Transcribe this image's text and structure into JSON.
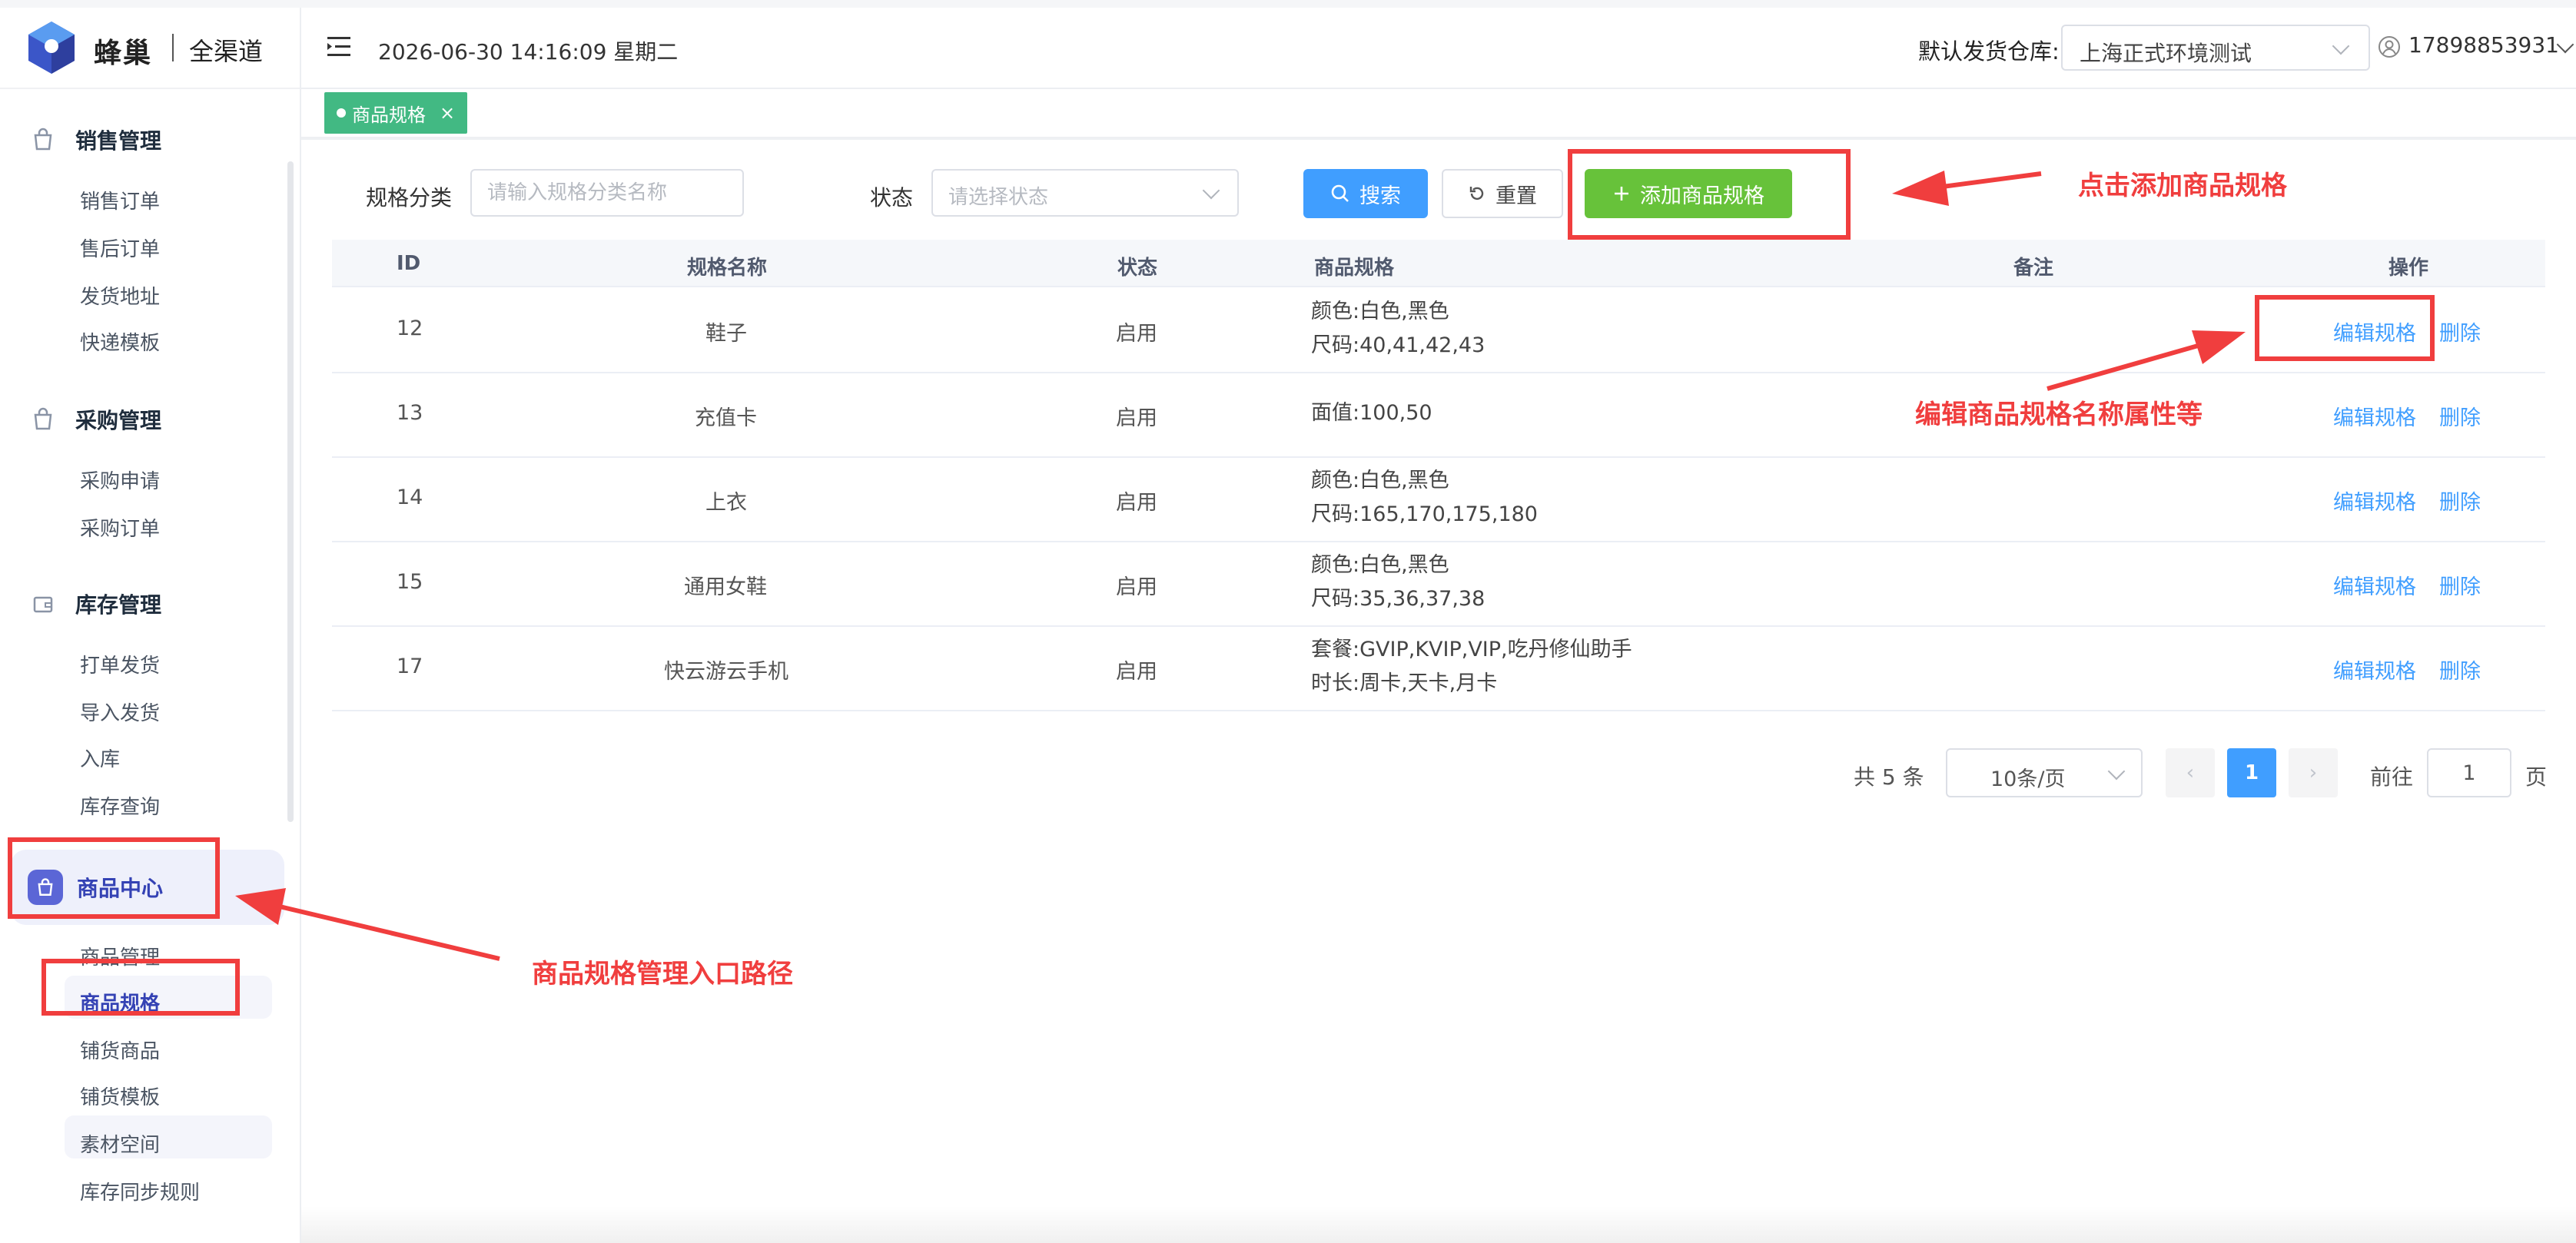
{
  "app": {
    "brand": "蜂巢",
    "sub": "全渠道",
    "datetime": "2026-06-30 14:16:09 星期二",
    "warehouse_label": "默认发货仓库:",
    "warehouse_value": "上海正式环境测试",
    "user": "17898853931"
  },
  "sidebar": {
    "groups": [
      {
        "label": "销售管理",
        "items": [
          "销售订单",
          "售后订单",
          "发货地址",
          "快递模板"
        ]
      },
      {
        "label": "采购管理",
        "items": [
          "采购申请",
          "采购订单"
        ]
      },
      {
        "label": "库存管理",
        "items": [
          "打单发货",
          "导入发货",
          "入库",
          "库存查询"
        ]
      },
      {
        "label": "商品中心",
        "items": [
          "商品管理",
          "商品规格",
          "铺货商品",
          "铺货模板",
          "素材空间",
          "库存同步规则"
        ]
      }
    ]
  },
  "tabs": [
    {
      "label": "商品规格"
    }
  ],
  "filters": {
    "category_label": "规格分类",
    "category_placeholder": "请输入规格分类名称",
    "status_label": "状态",
    "status_placeholder": "请选择状态",
    "search_btn": "搜索",
    "reset_btn": "重置",
    "add_btn": "添加商品规格"
  },
  "table": {
    "headers": [
      "ID",
      "规格名称",
      "状态",
      "商品规格",
      "备注",
      "操作"
    ],
    "rows": [
      {
        "id": "12",
        "name": "鞋子",
        "status": "启用",
        "spec": [
          "颜色:白色,黑色",
          "尺码:40,41,42,43"
        ],
        "note": "",
        "edit": "编辑规格",
        "delete": "删除"
      },
      {
        "id": "13",
        "name": "充值卡",
        "status": "启用",
        "spec": [
          "面值:100,50"
        ],
        "note": "",
        "edit": "编辑规格",
        "delete": "删除"
      },
      {
        "id": "14",
        "name": "上衣",
        "status": "启用",
        "spec": [
          "颜色:白色,黑色",
          "尺码:165,170,175,180"
        ],
        "note": "",
        "edit": "编辑规格",
        "delete": "删除"
      },
      {
        "id": "15",
        "name": "通用女鞋",
        "status": "启用",
        "spec": [
          "颜色:白色,黑色",
          "尺码:35,36,37,38"
        ],
        "note": "",
        "edit": "编辑规格",
        "delete": "删除"
      },
      {
        "id": "17",
        "name": "快云游云手机",
        "status": "启用",
        "spec": [
          "套餐:GVIP,KVIP,VIP,吃丹修仙助手",
          "时长:周卡,天卡,月卡"
        ],
        "note": "",
        "edit": "编辑规格",
        "delete": "删除"
      }
    ]
  },
  "pagination": {
    "total": "共 5 条",
    "page_size": "10条/页",
    "current": "1",
    "goto_label": "前往",
    "goto_value": "1",
    "page_suffix": "页"
  },
  "annotations": {
    "add": "点击添加商品规格",
    "edit": "编辑商品规格名称属性等",
    "entry": "商品规格管理入口路径"
  },
  "colors": {
    "primary": "#409eff",
    "success": "#67c23a",
    "tag": "#42b983",
    "annotation": "#f03e3e",
    "sidebar_active": "#5b66d6"
  }
}
